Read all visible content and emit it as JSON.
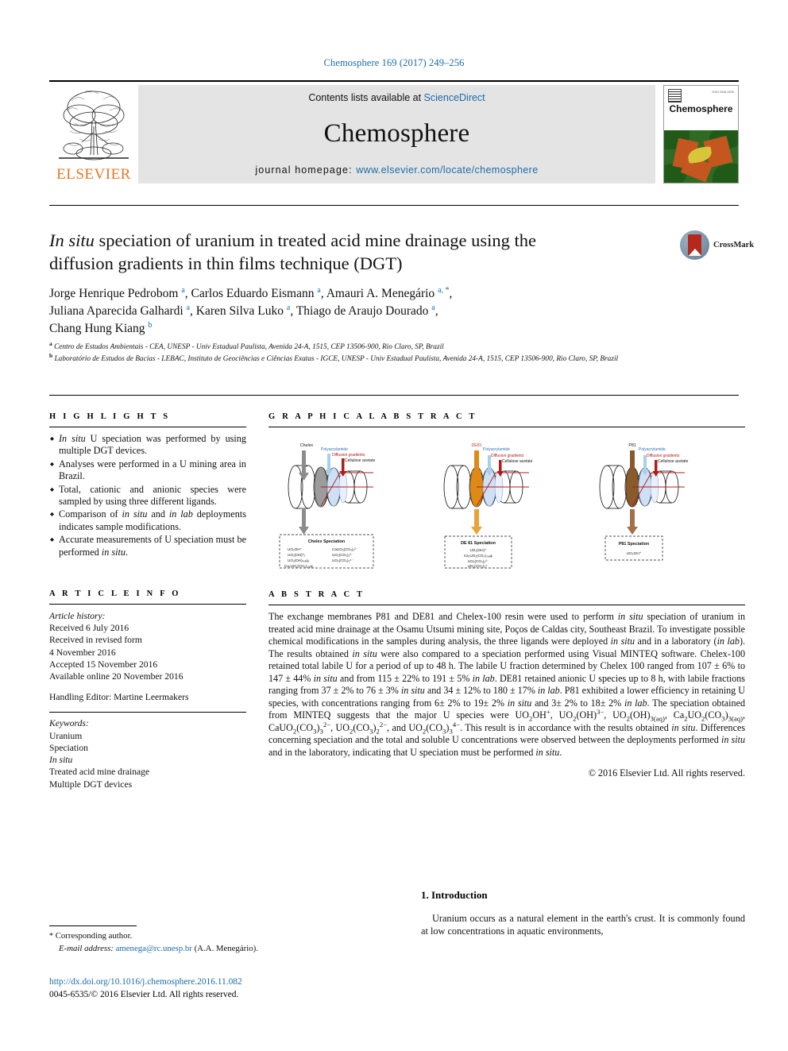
{
  "running_head": "Chemosphere 169 (2017) 249–256",
  "masthead": {
    "contents_prefix": "Contents lists available at ",
    "sciencedirect": "ScienceDirect",
    "journal_name": "Chemosphere",
    "homepage_prefix": "journal homepage: ",
    "homepage_url": "www.elsevier.com/locate/chemosphere",
    "publisher": "ELSEVIER",
    "cover_title": "Chemosphere",
    "cover_issn": "ISSN 0045-6535"
  },
  "article": {
    "title_line1_pre": "In situ",
    "title_line1_post": " speciation of uranium in treated acid mine drainage using the",
    "title_line2": "diffusion gradients in thin films technique (DGT)",
    "crossmark_label": "CrossMark",
    "authors": [
      {
        "name": "Jorge Henrique Pedrobom",
        "marks": "a"
      },
      {
        "name": "Carlos Eduardo Eismann",
        "marks": "a"
      },
      {
        "name": "Amauri A. Menegário",
        "marks": "a, *"
      },
      {
        "name": "Juliana Aparecida Galhardi",
        "marks": "a"
      },
      {
        "name": "Karen Silva Luko",
        "marks": "a"
      },
      {
        "name": "Thiago de Araujo Dourado",
        "marks": "a"
      },
      {
        "name": "Chang Hung Kiang",
        "marks": "b"
      }
    ],
    "affiliations": [
      {
        "mark": "a",
        "text": "Centro de Estudos Ambientais - CEA, UNESP - Univ Estadual Paulista, Avenida 24-A, 1515, CEP 13506-900, Rio Claro, SP, Brazil"
      },
      {
        "mark": "b",
        "text": "Laboratório de Estudos de Bacias - LEBAC, Instituto de Geociências e Ciências Exatas - IGCE, UNESP - Univ Estadual Paulista, Avenida 24-A, 1515, CEP 13506-900, Rio Claro, SP, Brazil"
      }
    ]
  },
  "highlights": {
    "heading": "H I G H L I G H T S",
    "items": [
      "In situ U speciation was performed by using multiple DGT devices.",
      "Analyses were performed in a U mining area in Brazil.",
      "Total, cationic and anionic species were sampled by using three different ligands.",
      "Comparison of in situ and in lab deployments indicates sample modifications.",
      "Accurate measurements of U speciation must be performed in situ."
    ]
  },
  "graphical_abstract": {
    "heading": "G R A P H I C A L   A B S T R A C T",
    "panels": [
      {
        "ligand": "Chelex",
        "ligand_color": "#808080",
        "layer_labels": [
          "Polyacrylamide",
          "Diffusion gradients",
          "Cellulose acetate"
        ],
        "box_title": "Chelex Speciation",
        "species_left": [
          "UO₂OH⁺",
          "UO₂(OH)⁰₂",
          "UO₂(OH)₃₍ₐq₎",
          "Ca₂UO₂(CO₃)₃₍ₐq₎"
        ],
        "species_right": [
          "CaUO₂(CO₃)₃²⁻",
          "UO₂(CO₃)₂²⁻",
          "UO₂(CO₃)₃⁴⁻"
        ]
      },
      {
        "ligand": "DE81",
        "ligand_color": "#e08a16",
        "layer_labels": [
          "Polyacrylamide",
          "Diffusion gradients",
          "Cellulose acetate"
        ],
        "box_title": "DE 81 Speciation",
        "species_left": [
          "UO₂(OH)⁺",
          "Ca₂UO₂(CO₃)₃₍ₐq₎",
          "UO₂(CO₃)₂²⁻",
          "UO₂(CO₃)₃⁴⁻"
        ],
        "species_right": []
      },
      {
        "ligand": "P81",
        "ligand_color": "#8b5a2b",
        "layer_labels": [
          "Polyacrylamide",
          "Diffusion gradients",
          "Cellulose acetate"
        ],
        "box_title": "P81 Speciation",
        "species_left": [
          "UO₂OH⁺"
        ],
        "species_right": []
      }
    ]
  },
  "article_info": {
    "heading": "A R T I C L E   I N F O",
    "history_label": "Article history:",
    "history": [
      "Received 6 July 2016",
      "Received in revised form",
      "4 November 2016",
      "Accepted 15 November 2016",
      "Available online 20 November 2016"
    ],
    "handling_editor": "Handling Editor: Martine Leermakers",
    "keywords_label": "Keywords:",
    "keywords": [
      "Uranium",
      "Speciation",
      "In situ",
      "Treated acid mine drainage",
      "Multiple DGT devices"
    ]
  },
  "abstract": {
    "heading": "A B S T R A C T",
    "paragraph_html": "The exchange membranes P81 and DE81 and Chelex-100 resin were used to perform <i>in situ</i> speciation of uranium in treated acid mine drainage at the Osamu Utsumi mining site, Poços de Caldas city, Southeast Brazil. To investigate possible chemical modifications in the samples during analysis, the three ligands were deployed <i>in situ</i> and in a laboratory (<i>in lab</i>). The results obtained <i>in situ</i> were also compared to a speciation performed using Visual MINTEQ software. Chelex-100 retained total labile U for a period of up to 48 h. The labile U fraction determined by Chelex 100 ranged from 107 ± 6% to 147 ± 44% <i>in situ</i> and from 115 ± 22% to 191 ± 5% <i>in lab</i>. DE81 retained anionic U species up to 8 h, with labile fractions ranging from 37 ± 2% to 76 ± 3% <i>in situ</i> and 34 ± 12% to 180 ± 17% <i>in lab</i>. P81 exhibited a lower efficiency in retaining U species, with concentrations ranging from 6± 2% to 19± 2% <i>in situ</i> and 3± 2% to 18± 2% <i>in lab</i>. The speciation obtained from MINTEQ suggests that the major U species were UO<sub>2</sub>OH<sup>+</sup>, UO<sub>2</sub>(OH)<sup>3−</sup>, UO<sub>2</sub>(OH)<sub>3(aq)</sub>, Ca<sub>2</sub>UO<sub>2</sub>(CO<sub>3</sub>)<sub>3(aq)</sub>, CaUO<sub>2</sub>(CO<sub>3</sub>)<sub>3</sub><sup>2−</sup>, UO<sub>2</sub>(CO<sub>3</sub>)<sub>2</sub><sup>2−</sup>, and UO<sub>2</sub>(CO<sub>3</sub>)<sub>3</sub><sup>4−</sup>. This result is in accordance with the results obtained <i>in situ</i>. Differences concerning speciation and the total and soluble U concentrations were observed between the deployments performed <i>in situ</i> and in the laboratory, indicating that U speciation must be performed <i>in situ</i>.",
    "copyright": "© 2016 Elsevier Ltd. All rights reserved."
  },
  "introduction": {
    "number": "1.",
    "title": "Introduction",
    "paragraph": "Uranium occurs as a natural element in the earth's crust. It is commonly found at low concentrations in aquatic environments,"
  },
  "footer": {
    "corresponding_star": "*",
    "corresponding_label": "Corresponding author.",
    "email_label": "E-mail address:",
    "email": "amenega@rc.unesp.br",
    "email_suffix": "(A.A. Menegário).",
    "doi": "http://dx.doi.org/10.1016/j.chemosphere.2016.11.082",
    "issn_line": "0045-6535/© 2016 Elsevier Ltd. All rights reserved."
  }
}
